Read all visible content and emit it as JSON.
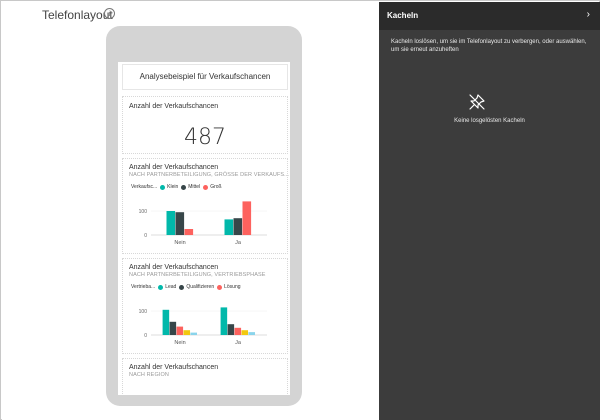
{
  "left_pane": {
    "title": "Telefonlayout",
    "info_glyph": "i"
  },
  "dashboard": {
    "title": "Analysebeispiel für Verkaufschancen",
    "tile_kpi": {
      "title": "Anzahl der Verkaufschancen",
      "value": "487"
    },
    "tile_chart1": {
      "title": "Anzahl der Verkaufschancen",
      "subtitle": "NACH PARTNERBETEILIGUNG, GRÖSSE DER VERKAUFS...",
      "legend_title": "Verkaufsc...",
      "legend": [
        "Klein",
        "Mittel",
        "Groß"
      ]
    },
    "tile_chart2": {
      "title": "Anzahl der Verkaufschancen",
      "subtitle": "NACH PARTNERBETEILIGUNG, VERTRIEBSPHASE",
      "legend_title": "Vertrieba...",
      "legend": [
        "Lead",
        "Qualifizieren",
        "Lösung"
      ]
    },
    "tile_region": {
      "title": "Anzahl der Verkaufschancen",
      "subtitle": "NACH REGION"
    }
  },
  "chart_data": [
    {
      "type": "bar",
      "categories": [
        "Nein",
        "Ja"
      ],
      "series": [
        {
          "name": "Klein",
          "values": [
            100,
            65
          ]
        },
        {
          "name": "Mittel",
          "values": [
            95,
            70
          ]
        },
        {
          "name": "Groß",
          "values": [
            25,
            140
          ]
        }
      ],
      "yticks": [
        "100",
        "0"
      ],
      "ylim": [
        0,
        150
      ],
      "colors": [
        "#01b8aa",
        "#374649",
        "#fd625e"
      ]
    },
    {
      "type": "bar",
      "categories": [
        "Nein",
        "Ja"
      ],
      "series": [
        {
          "name": "Lead",
          "values": [
            105,
            115
          ]
        },
        {
          "name": "Qualifizieren",
          "values": [
            55,
            45
          ]
        },
        {
          "name": "Lösung",
          "values": [
            35,
            30
          ]
        },
        {
          "name": "",
          "values": [
            20,
            20
          ]
        },
        {
          "name": "",
          "values": [
            10,
            12
          ]
        }
      ],
      "yticks": [
        "100",
        "0"
      ],
      "ylim": [
        0,
        150
      ],
      "colors": [
        "#01b8aa",
        "#374649",
        "#fd625e",
        "#f2c80f",
        "#8ad4eb"
      ]
    }
  ],
  "right_pane": {
    "title": "Kacheln",
    "chevron": "›",
    "description": "Kacheln loslösen, um sie im Telefonlayout zu verbergen, oder auswählen, um sie erneut anzuheften",
    "empty_text": "Keine losgelösten Kacheln",
    "icon": "unpin-icon"
  },
  "colors": {
    "teal": "#01b8aa",
    "dark": "#374649",
    "red": "#fd625e",
    "yellow": "#f2c80f",
    "panel_bg": "#3c3c3c"
  }
}
